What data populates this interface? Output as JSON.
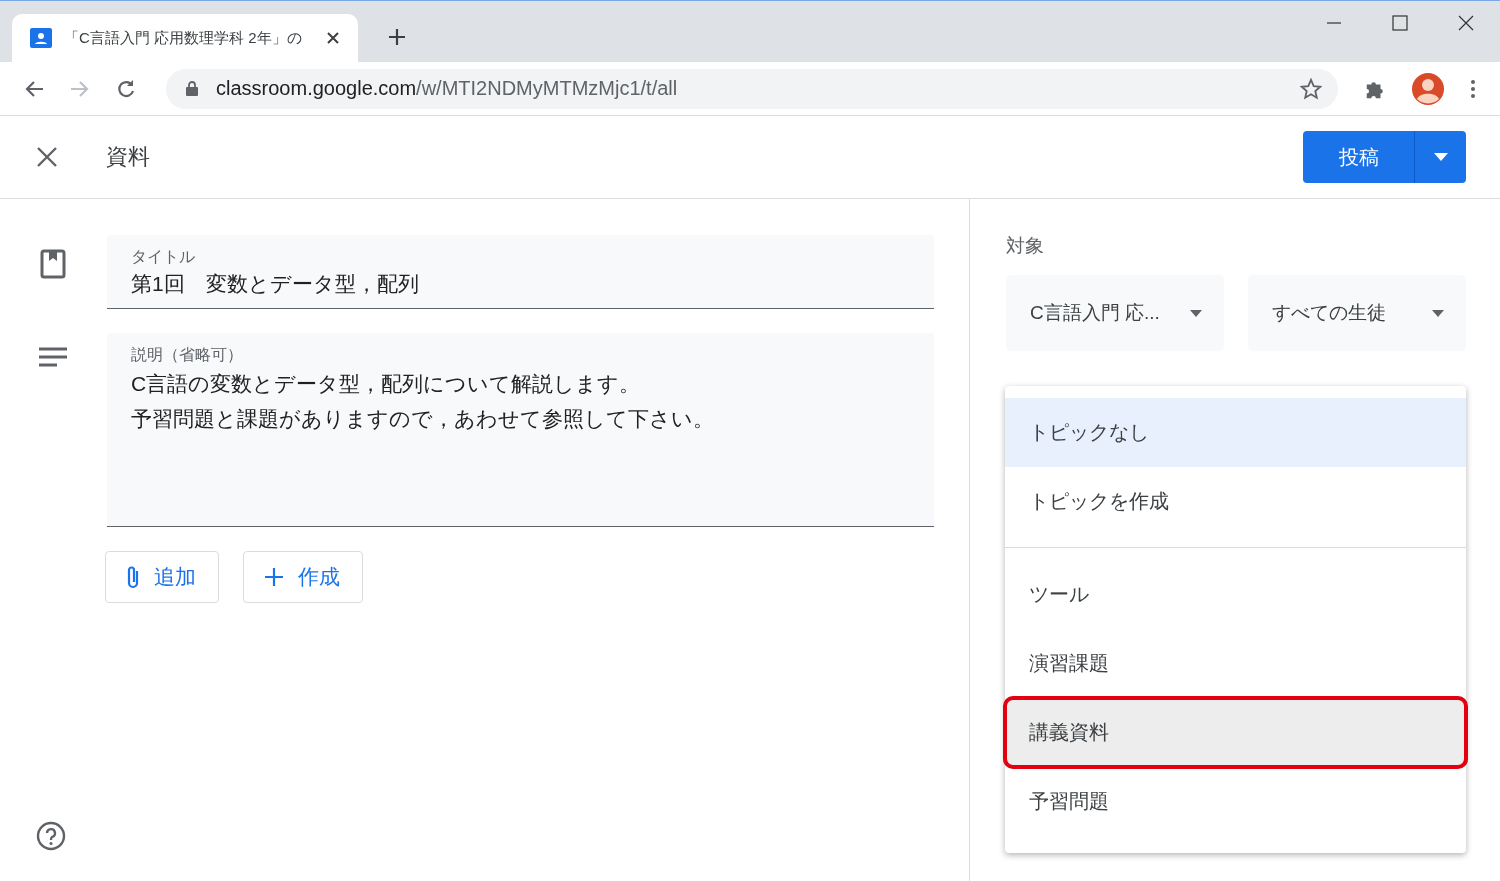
{
  "browser": {
    "tab_title": "「C言語入門 応用数理学科 2年」の",
    "url_host": "classroom.google.com",
    "url_path": "/w/MTI2NDMyMTMzMjc1/t/all"
  },
  "header": {
    "title": "資料",
    "post_button": "投稿"
  },
  "form": {
    "title_field": {
      "placeholder": "タイトル",
      "value": "第1回　変数とデータ型，配列"
    },
    "description_field": {
      "placeholder": "説明（省略可）",
      "lines": [
        "C言語の変数とデータ型，配列について解説します。",
        "予習問題と課題がありますので，あわせて参照して下さい。"
      ]
    },
    "buttons": [
      {
        "kind": "attach",
        "label": "追加"
      },
      {
        "kind": "create",
        "label": "作成"
      }
    ]
  },
  "side": {
    "audience_label": "対象",
    "class_select": "C言語入門 応...",
    "students_select": "すべての生徒",
    "topic_menu": [
      {
        "kind": "option",
        "label": "トピックなし",
        "selected": true,
        "hovered": false,
        "marked": false
      },
      {
        "kind": "option",
        "label": "トピックを作成",
        "selected": false,
        "hovered": false,
        "marked": false
      },
      {
        "kind": "divider"
      },
      {
        "kind": "option",
        "label": "ツール",
        "selected": false,
        "hovered": false,
        "marked": false
      },
      {
        "kind": "option",
        "label": "演習課題",
        "selected": false,
        "hovered": false,
        "marked": false
      },
      {
        "kind": "option",
        "label": "講義資料",
        "selected": false,
        "hovered": true,
        "marked": true
      },
      {
        "kind": "option",
        "label": "予習問題",
        "selected": false,
        "hovered": false,
        "marked": false
      }
    ]
  }
}
